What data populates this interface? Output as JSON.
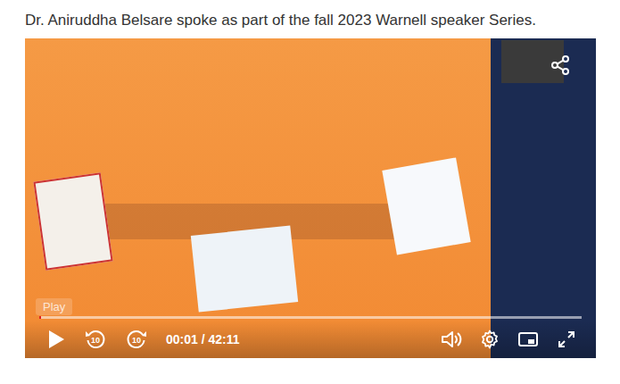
{
  "caption": "Dr. Aniruddha Belsare spoke as part of the fall 2023 Warnell speaker Series.",
  "player": {
    "playing": false,
    "tooltip": "Play",
    "progress": {
      "level": 0.0004
    },
    "skip_back": "10",
    "skip_forward": "10",
    "time": "00:01 / 42:11"
  }
}
